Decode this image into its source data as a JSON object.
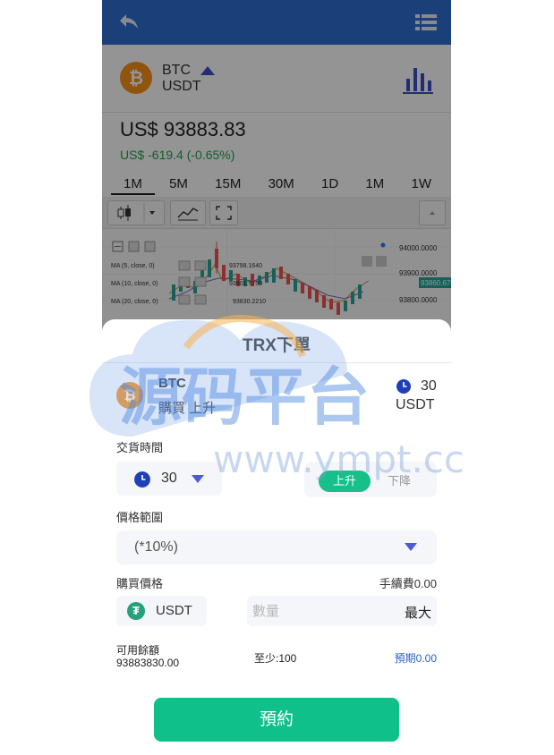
{
  "header": {
    "back_icon": "back-arrow-icon",
    "menu_icon": "list-menu-icon"
  },
  "coin": {
    "symbol": "BTC",
    "quote": "USDT",
    "trend_icon": "triangle-up-icon",
    "chart_icon": "bar-chart-icon"
  },
  "price": {
    "current": "US$ 93883.83",
    "change": "US$ -619.4 (-0.65%)"
  },
  "timeframes": [
    {
      "label": "1M",
      "active": true
    },
    {
      "label": "5M"
    },
    {
      "label": "15M"
    },
    {
      "label": "30M"
    },
    {
      "label": "1D"
    },
    {
      "label": "1M"
    },
    {
      "label": "1W"
    }
  ],
  "kline": {
    "ma": [
      "MA (5, close, 0)",
      "MA (10, close, 0)",
      "MA (20, close, 0)"
    ],
    "ma_values": [
      "93798.1640",
      "93801.7750",
      "93830.2210"
    ],
    "y_ticks": [
      "94000.0000",
      "93900.0000",
      "93800.0000"
    ],
    "current_tag": "93860.6700"
  },
  "order": {
    "title": "TRX下單",
    "coin": "BTC",
    "direction_text": "購買 上升",
    "time": "30",
    "unit": "USDT",
    "delivery_label": "交貨時間",
    "delivery_value": "30",
    "dir_up": "上升",
    "dir_down": "下降",
    "range_label": "價格範圍",
    "range_value": "(*10%)",
    "buy_price_label": "購買價格",
    "fee": "手續費0.00",
    "currency": "USDT",
    "amount_placeholder": "數量",
    "max_label": "最大",
    "balance_label": "可用餘額",
    "balance_value": "93883830.00",
    "min_amount": "至少:100",
    "expected": "預期0.00",
    "submit": "預約"
  },
  "watermark": {
    "cn": "源码平台",
    "url": "www.ympt.cc"
  },
  "colors": {
    "header": "#2f6fd0",
    "accent_green": "#16c088",
    "submit": "#0fc08a",
    "link_blue": "#2a63c8",
    "btc": "#f7931a"
  }
}
